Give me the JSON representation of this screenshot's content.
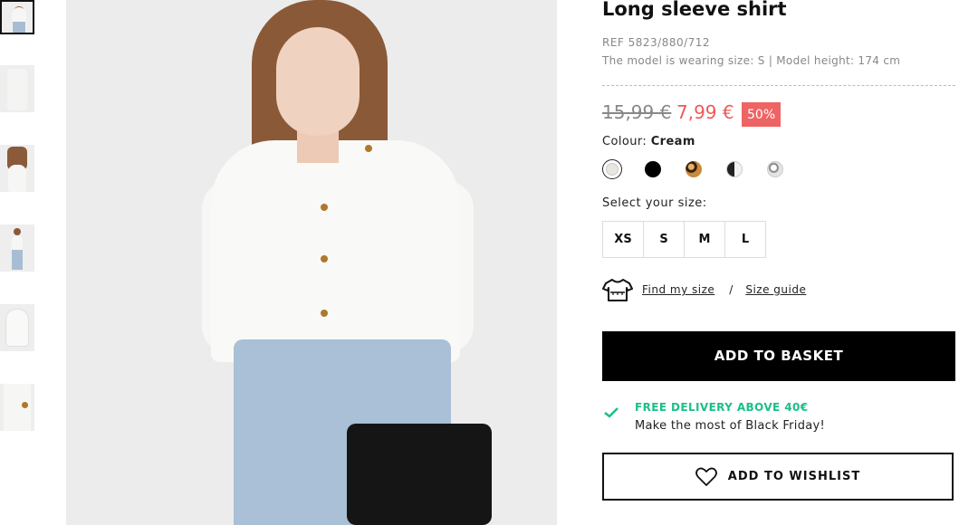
{
  "product": {
    "title": "Long sleeve shirt",
    "ref": "REF 5823/880/712",
    "model_info": "The model is wearing size: S | Model height: 174 cm",
    "price_old": "15,99 €",
    "price_new": "7,99 €",
    "discount": "50%",
    "colour_label": "Colour:",
    "colour_value": "Cream",
    "size_label": "Select your size:",
    "sizes": [
      "XS",
      "S",
      "M",
      "L"
    ],
    "find_size": "Find my size",
    "separator": "/",
    "size_guide": "Size guide",
    "add_to_basket": "ADD TO BASKET",
    "delivery_title": "FREE DELIVERY ABOVE 40€",
    "delivery_sub": "Make the most of Black Friday!",
    "add_to_wishlist": "ADD TO WISHLIST"
  },
  "swatch_colors": [
    "#e8e6df",
    "#000000",
    "#6b3b1a",
    "#2a2a2a",
    "#d8d8d8"
  ],
  "colors": {
    "accent_sale": "#ee5a5a",
    "delivery_green": "#1bbf8a"
  },
  "thumbnail_count": 6
}
